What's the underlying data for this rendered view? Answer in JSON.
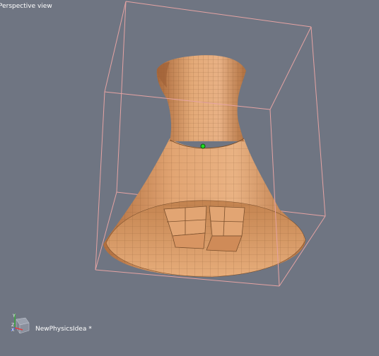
{
  "viewport": {
    "label": "Perspective view",
    "background": "#6f7582"
  },
  "scene": {
    "name": "NewPhysicsIdea",
    "modified_marker": "*"
  },
  "model": {
    "fill_color": "#d99a63",
    "wire_color": "#7a4f2c",
    "bounding_box_color": "#e5a3a3",
    "pivot_color": "#22dd22"
  },
  "gizmo": {
    "axes": [
      "Y",
      "Z",
      "X"
    ],
    "colors": {
      "x": "#e33a3a",
      "y": "#3aa83a",
      "z": "#3a58e8"
    }
  }
}
